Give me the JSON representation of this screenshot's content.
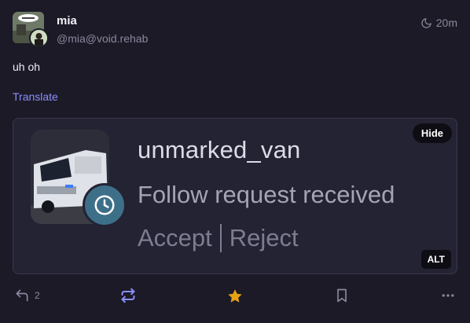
{
  "account": {
    "display_name": "mia",
    "handle": "@mia@void.rehab",
    "relative_time": "20m",
    "visibility_icon": "moon-icon"
  },
  "status": {
    "content": "uh oh",
    "translate_label": "Translate"
  },
  "media": {
    "notification_title": "unmarked_van",
    "notification_subtitle": "Follow request received",
    "accept_label": "Accept",
    "reject_label": "Reject",
    "hide_label": "Hide",
    "alt_label": "ALT"
  },
  "actions": {
    "reply_count": "2",
    "reply_icon": "reply-icon",
    "boost_icon": "boost-icon",
    "favourite_icon": "star-icon",
    "bookmark_icon": "bookmark-icon",
    "more_icon": "more-icon"
  },
  "colors": {
    "background": "#1b1a26",
    "link": "#8c8dff",
    "boost_active": "#8c8dff",
    "favourite_active": "#e6a117",
    "muted": "#8a889f"
  }
}
